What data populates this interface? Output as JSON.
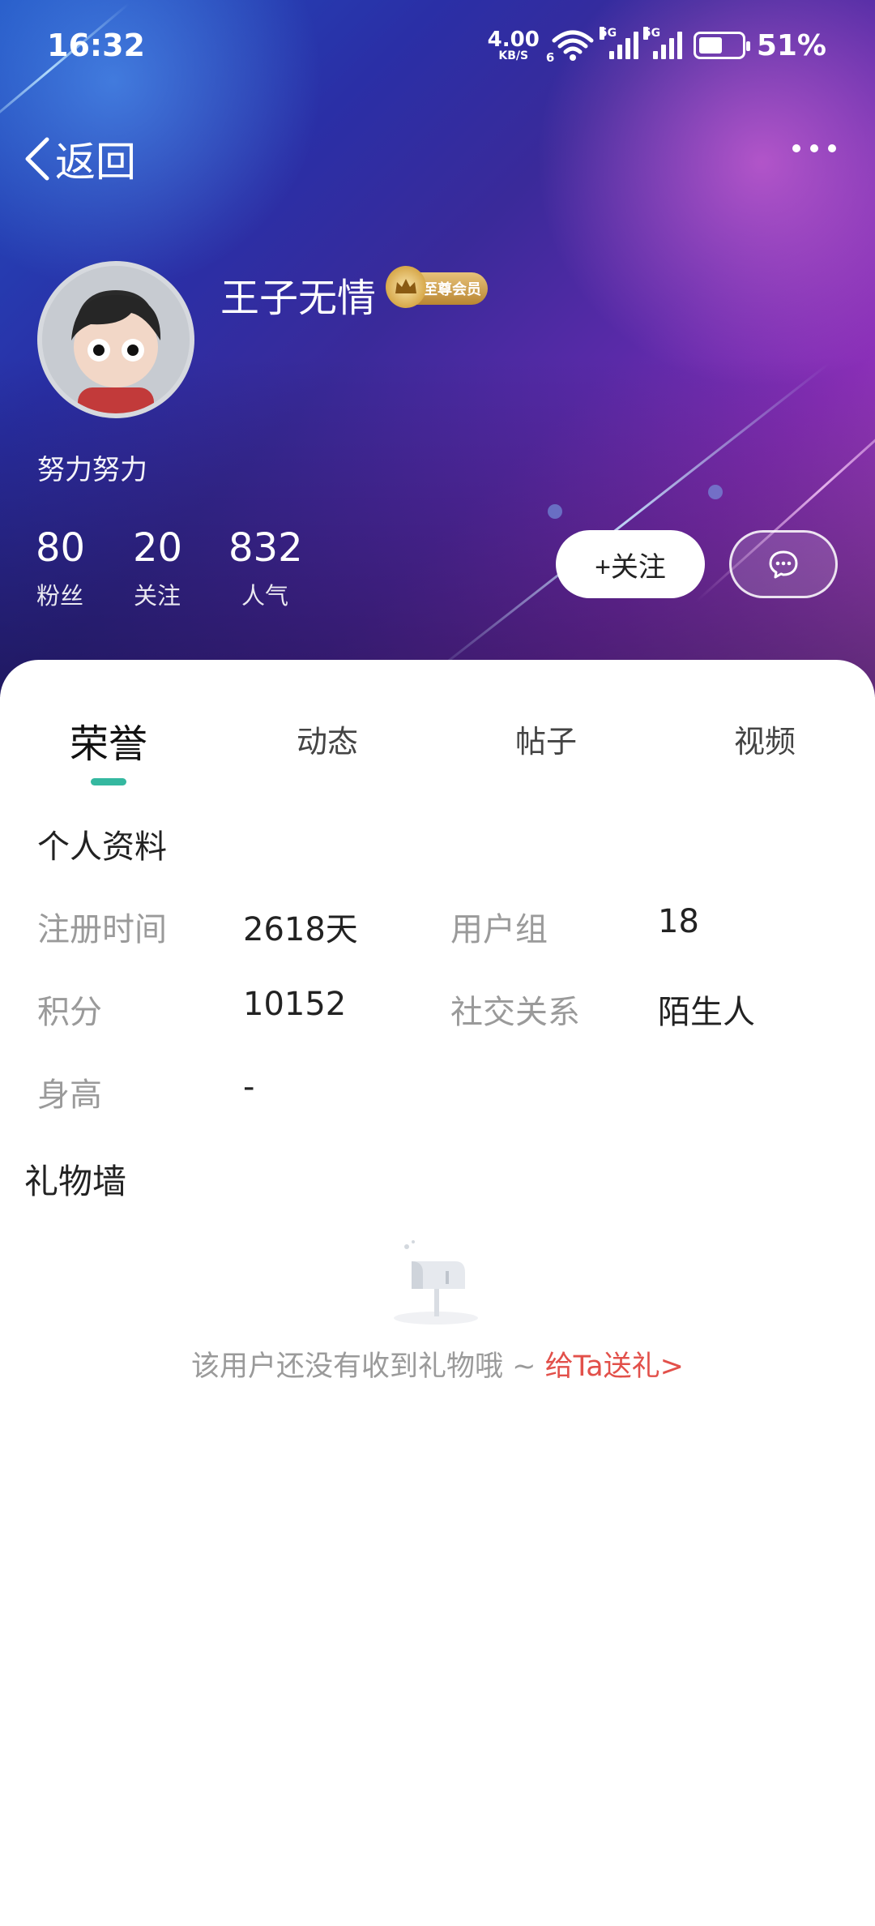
{
  "status_bar": {
    "time": "16:32",
    "net_speed_value": "4.00",
    "net_speed_unit": "KB/S",
    "wifi_num": "6",
    "sim1": "5G",
    "sim2": "5G",
    "battery_percent": "51%",
    "battery_level": 0.51
  },
  "nav": {
    "back_label": "返回",
    "more_icon": "more-dots-icon"
  },
  "profile": {
    "username": "王子无情",
    "vip_badge_text": "至尊会员",
    "signature": "努力努力",
    "stats": [
      {
        "value": "80",
        "label": "粉丝"
      },
      {
        "value": "20",
        "label": "关注"
      },
      {
        "value": "832",
        "label": "人气"
      }
    ],
    "follow_label": "+关注",
    "chat_icon": "chat-bubble-icon"
  },
  "tabs": [
    {
      "label": "荣誉",
      "active": true
    },
    {
      "label": "动态",
      "active": false
    },
    {
      "label": "帖子",
      "active": false
    },
    {
      "label": "视频",
      "active": false
    }
  ],
  "personal_info": {
    "title": "个人资料",
    "fields": [
      {
        "label": "注册时间",
        "value": "2618天"
      },
      {
        "label": "用户组",
        "value": "18"
      },
      {
        "label": "积分",
        "value": "10152"
      },
      {
        "label": "社交关系",
        "value": "陌生人"
      },
      {
        "label": "身高",
        "value": "-"
      }
    ]
  },
  "gift_wall": {
    "title": "礼物墙",
    "empty_text": "该用户还没有收到礼物哦 ~ ",
    "send_link": "给Ta送礼>"
  },
  "colors": {
    "accent_teal": "#35b8a0",
    "link_red": "#e2504a"
  }
}
